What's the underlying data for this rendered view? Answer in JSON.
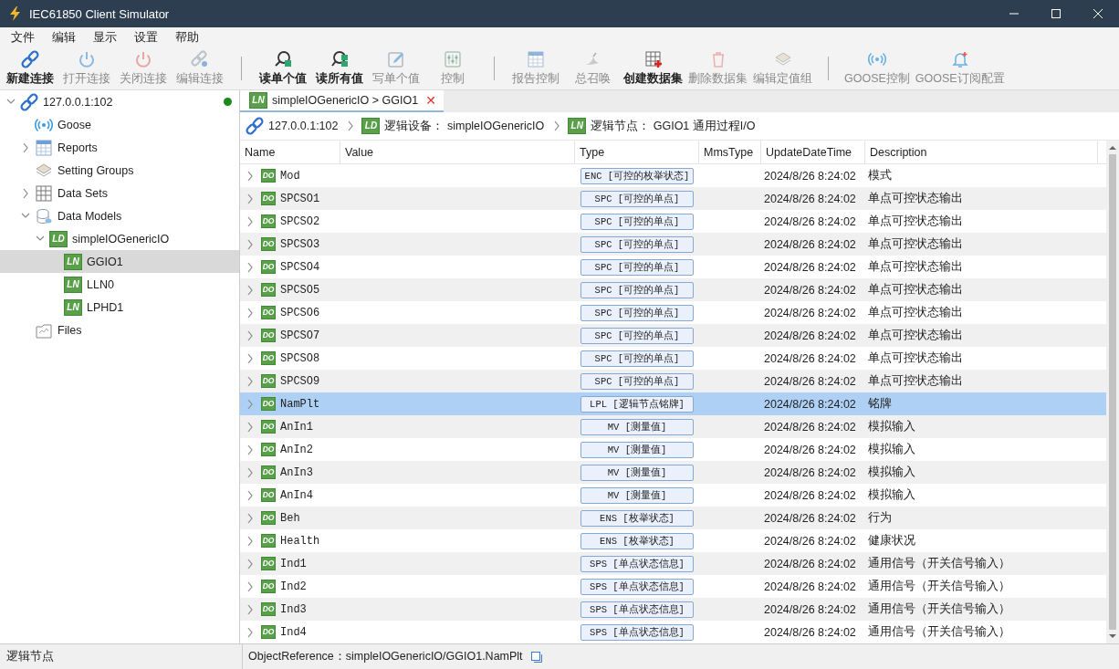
{
  "window": {
    "title": "IEC61850 Client Simulator"
  },
  "menu": [
    "文件",
    "编辑",
    "显示",
    "设置",
    "帮助"
  ],
  "toolbar": [
    {
      "kind": "connect",
      "label": "新建连接",
      "disabled": false
    },
    {
      "kind": "power-on",
      "label": "打开连接",
      "disabled": true
    },
    {
      "kind": "power-off",
      "label": "关闭连接",
      "disabled": true
    },
    {
      "kind": "edit-connect",
      "label": "编辑连接",
      "disabled": true
    },
    {
      "kind": "separator"
    },
    {
      "kind": "read-one",
      "label": "读单个值",
      "disabled": false
    },
    {
      "kind": "read-all",
      "label": "读所有值",
      "disabled": false
    },
    {
      "kind": "write",
      "label": "写单个值",
      "disabled": true
    },
    {
      "kind": "control",
      "label": "控制",
      "disabled": true
    },
    {
      "kind": "separator"
    },
    {
      "kind": "report",
      "label": "报告控制",
      "disabled": true
    },
    {
      "kind": "gi",
      "label": "总召唤",
      "disabled": true
    },
    {
      "kind": "dataset-add",
      "label": "创建数据集",
      "disabled": false
    },
    {
      "kind": "delete",
      "label": "删除数据集",
      "disabled": true
    },
    {
      "kind": "layers",
      "label": "编辑定值组",
      "disabled": true
    },
    {
      "kind": "separator"
    },
    {
      "kind": "goose",
      "label": "GOOSE控制",
      "disabled": true
    },
    {
      "kind": "bell",
      "label": "GOOSE订阅配置",
      "disabled": true
    }
  ],
  "tree": [
    {
      "kind": "host",
      "label": "127.0.0.1:102",
      "expanded": true,
      "connected": true,
      "selected": false,
      "children": [
        {
          "kind": "goose",
          "label": "Goose",
          "selected": false
        },
        {
          "kind": "reports",
          "label": "Reports",
          "expanded": false,
          "selected": false
        },
        {
          "kind": "settings",
          "label": "Setting Groups",
          "selected": false
        },
        {
          "kind": "datasets",
          "label": "Data Sets",
          "expanded": false,
          "selected": false
        },
        {
          "kind": "models",
          "label": "Data Models",
          "expanded": true,
          "selected": false,
          "children": [
            {
              "kind": "ld",
              "badge": "LD",
              "label": "simpleIOGenericIO",
              "expanded": true,
              "selected": false,
              "children": [
                {
                  "kind": "ln",
                  "badge": "LN",
                  "label": "GGIO1",
                  "selected": true
                },
                {
                  "kind": "ln",
                  "badge": "LN",
                  "label": "LLN0",
                  "selected": false
                },
                {
                  "kind": "ln",
                  "badge": "LN",
                  "label": "LPHD1",
                  "selected": false
                }
              ]
            }
          ]
        },
        {
          "kind": "files",
          "label": "Files",
          "selected": false
        }
      ]
    }
  ],
  "tab": {
    "badge": "LN",
    "label": "simpleIOGenericIO",
    "separator": ">",
    "node": "GGIO1",
    "close": "✕"
  },
  "breadcrumb": [
    {
      "kind": "host",
      "text": "127.0.0.1:102"
    },
    {
      "kind": "ld",
      "badge": "LD",
      "text": "逻辑设备：  simpleIOGenericIO"
    },
    {
      "kind": "ln",
      "badge": "LN",
      "text": "逻辑节点：  GGIO1  通用过程I/O"
    }
  ],
  "table": {
    "columns": [
      "Name",
      "Value",
      "Type",
      "MmsType",
      "UpdateDateTime",
      "Description"
    ],
    "rows": [
      {
        "badge": "DO",
        "name": "Mod",
        "type": "ENC [可控的枚举状态]",
        "time": "2024/8/26 8:24:02",
        "description": "模式",
        "selected": false
      },
      {
        "badge": "DO",
        "name": "SPCSO1",
        "type": "SPC [可控的单点]",
        "time": "2024/8/26 8:24:02",
        "description": "单点可控状态输出",
        "selected": false
      },
      {
        "badge": "DO",
        "name": "SPCSO2",
        "type": "SPC [可控的单点]",
        "time": "2024/8/26 8:24:02",
        "description": "单点可控状态输出",
        "selected": false
      },
      {
        "badge": "DO",
        "name": "SPCSO3",
        "type": "SPC [可控的单点]",
        "time": "2024/8/26 8:24:02",
        "description": "单点可控状态输出",
        "selected": false
      },
      {
        "badge": "DO",
        "name": "SPCSO4",
        "type": "SPC [可控的单点]",
        "time": "2024/8/26 8:24:02",
        "description": "单点可控状态输出",
        "selected": false
      },
      {
        "badge": "DO",
        "name": "SPCSO5",
        "type": "SPC [可控的单点]",
        "time": "2024/8/26 8:24:02",
        "description": "单点可控状态输出",
        "selected": false
      },
      {
        "badge": "DO",
        "name": "SPCSO6",
        "type": "SPC [可控的单点]",
        "time": "2024/8/26 8:24:02",
        "description": "单点可控状态输出",
        "selected": false
      },
      {
        "badge": "DO",
        "name": "SPCSO7",
        "type": "SPC [可控的单点]",
        "time": "2024/8/26 8:24:02",
        "description": "单点可控状态输出",
        "selected": false
      },
      {
        "badge": "DO",
        "name": "SPCSO8",
        "type": "SPC [可控的单点]",
        "time": "2024/8/26 8:24:02",
        "description": "单点可控状态输出",
        "selected": false
      },
      {
        "badge": "DO",
        "name": "SPCSO9",
        "type": "SPC [可控的单点]",
        "time": "2024/8/26 8:24:02",
        "description": "单点可控状态输出",
        "selected": false
      },
      {
        "badge": "DO",
        "name": "NamPlt",
        "type": "LPL [逻辑节点铭牌]",
        "time": "2024/8/26 8:24:02",
        "description": "铭牌",
        "selected": true
      },
      {
        "badge": "DO",
        "name": "AnIn1",
        "type": "MV [测量值]",
        "time": "2024/8/26 8:24:02",
        "description": "模拟输入",
        "selected": false
      },
      {
        "badge": "DO",
        "name": "AnIn2",
        "type": "MV [测量值]",
        "time": "2024/8/26 8:24:02",
        "description": "模拟输入",
        "selected": false
      },
      {
        "badge": "DO",
        "name": "AnIn3",
        "type": "MV [测量值]",
        "time": "2024/8/26 8:24:02",
        "description": "模拟输入",
        "selected": false
      },
      {
        "badge": "DO",
        "name": "AnIn4",
        "type": "MV [测量值]",
        "time": "2024/8/26 8:24:02",
        "description": "模拟输入",
        "selected": false
      },
      {
        "badge": "DO",
        "name": "Beh",
        "type": "ENS [枚举状态]",
        "time": "2024/8/26 8:24:02",
        "description": "行为",
        "selected": false
      },
      {
        "badge": "DO",
        "name": "Health",
        "type": "ENS [枚举状态]",
        "time": "2024/8/26 8:24:02",
        "description": "健康状况",
        "selected": false
      },
      {
        "badge": "DO",
        "name": "Ind1",
        "type": "SPS [单点状态信息]",
        "time": "2024/8/26 8:24:02",
        "description": "通用信号（开关信号输入）",
        "selected": false
      },
      {
        "badge": "DO",
        "name": "Ind2",
        "type": "SPS [单点状态信息]",
        "time": "2024/8/26 8:24:02",
        "description": "通用信号（开关信号输入）",
        "selected": false
      },
      {
        "badge": "DO",
        "name": "Ind3",
        "type": "SPS [单点状态信息]",
        "time": "2024/8/26 8:24:02",
        "description": "通用信号（开关信号输入）",
        "selected": false
      },
      {
        "badge": "DO",
        "name": "Ind4",
        "type": "SPS [单点状态信息]",
        "time": "2024/8/26 8:24:02",
        "description": "通用信号（开关信号输入）",
        "selected": false
      }
    ]
  },
  "status_bar": {
    "left": "逻辑节点",
    "reference": "ObjectReference：simpleIOGenericIO/GGIO1.NamPlt"
  }
}
